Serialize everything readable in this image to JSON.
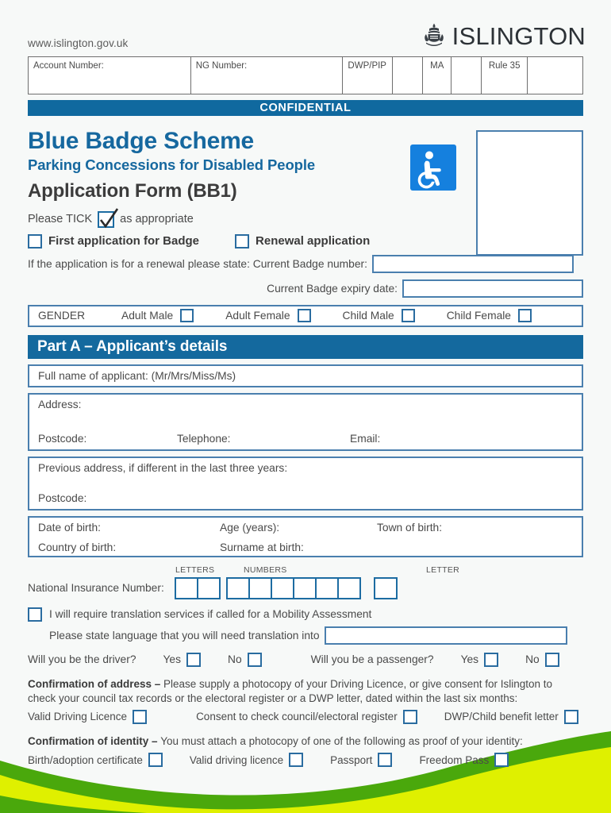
{
  "header": {
    "site_url": "www.islington.gov.uk",
    "brand_name": "ISLINGTON",
    "crest_icon": "coat-of-arms-icon"
  },
  "admin_table": {
    "cells": [
      {
        "label": "Account Number:"
      },
      {
        "label": "NG Number:"
      },
      {
        "label": "DWP/PIP"
      },
      {
        "label": ""
      },
      {
        "label": "MA"
      },
      {
        "label": ""
      },
      {
        "label": "Rule 35"
      },
      {
        "label": ""
      }
    ]
  },
  "confidential_bar": "CONFIDENTIAL",
  "title": {
    "main": "Blue Badge Scheme",
    "sub": "Parking Concessions for Disabled People",
    "form": "Application Form (BB1)",
    "wheelchair_icon": "wheelchair-accessible-icon",
    "accent_blue": "#16689f",
    "icon_blue": "#1580de"
  },
  "tick_instruction": {
    "prefix": "Please TICK",
    "suffix": "as appropriate"
  },
  "application_type": {
    "first": "First application for Badge",
    "renewal": "Renewal application"
  },
  "renewal": {
    "intro": "If the application is for a renewal please state: Current Badge number:",
    "badge_number_value": "",
    "expiry_label": "Current Badge expiry date:",
    "expiry_value": ""
  },
  "gender": {
    "label": "GENDER",
    "options": [
      "Adult Male",
      "Adult Female",
      "Child Male",
      "Child Female"
    ]
  },
  "part_a": {
    "banner": "Part A – Applicant’s details",
    "full_name_label": "Full name of applicant: (Mr/Mrs/Miss/Ms)",
    "address_label": "Address:",
    "postcode_label": "Postcode:",
    "telephone_label": "Telephone:",
    "email_label": "Email:",
    "previous_address_label": "Previous address, if different in the last three years:",
    "previous_postcode_label": "Postcode:",
    "dob_label": "Date of birth:",
    "age_label": "Age (years):",
    "town_label": "Town of birth:",
    "country_label": "Country of birth:",
    "surname_label": "Surname at birth:"
  },
  "ni": {
    "label": "National Insurance Number:",
    "cap_letters": "LETTERS",
    "cap_numbers": "NUMBERS",
    "cap_letter": "LETTER",
    "letters_count": 2,
    "numbers_count": 6,
    "letter_count": 1
  },
  "translation": {
    "checkbox_text": "I will require translation services if called for a Mobility Assessment",
    "language_label": "Please state language that you will need translation into",
    "language_value": ""
  },
  "transport": {
    "driver_question": "Will you be the driver?",
    "driver_yes": "Yes",
    "driver_no": "No",
    "passenger_question": "Will you be a passenger?",
    "passenger_yes": "Yes",
    "passenger_no": "No"
  },
  "confirmation_address": {
    "heading": "Confirmation of address – ",
    "body": "Please supply a photocopy of your Driving Licence, or give consent for Islington to check your council tax records or the electoral register or a DWP letter, dated within the last six months:",
    "options": [
      "Valid Driving Licence",
      "Consent to check council/electoral register",
      "DWP/Child benefit letter"
    ]
  },
  "confirmation_identity": {
    "heading": "Confirmation of identity – ",
    "body": "You must attach a photocopy of one of the following as proof of your identity:",
    "options": [
      "Birth/adoption certificate",
      "Valid driving licence",
      "Passport",
      "Freedom Pass"
    ]
  },
  "decoration": {
    "wave_dark_green": "#4aa80c",
    "wave_light_green": "#dff000"
  }
}
